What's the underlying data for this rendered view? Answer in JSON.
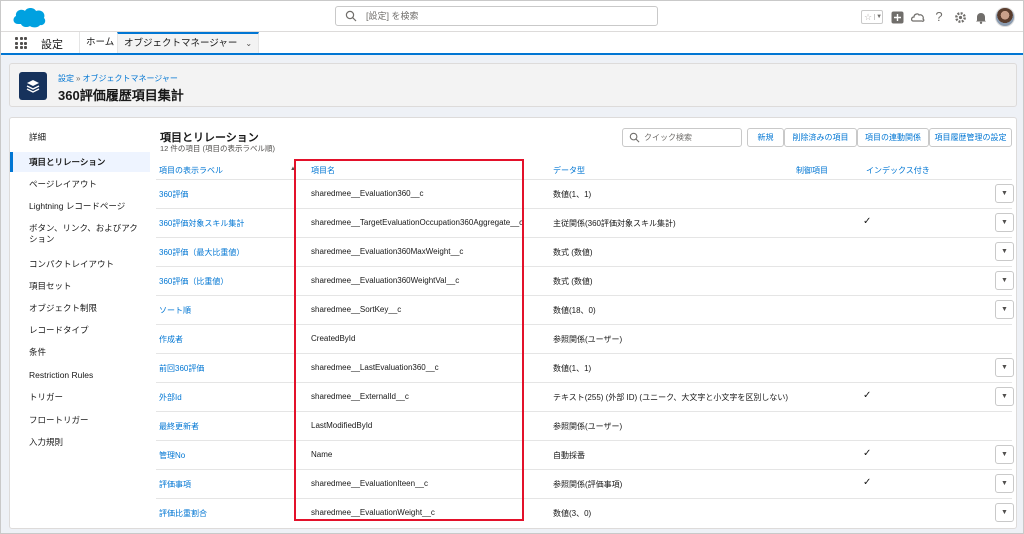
{
  "header": {
    "search_placeholder": "[設定] を検索"
  },
  "nav": {
    "app_name": "設定",
    "tabs": [
      {
        "label": "ホーム"
      },
      {
        "label": "オブジェクトマネージャー"
      }
    ]
  },
  "page": {
    "breadcrumb": [
      "設定",
      "オブジェクトマネージャー"
    ],
    "breadcrumb_sep": "»",
    "title": "360評価履歴項目集計"
  },
  "sidebar": {
    "items": [
      {
        "label": "詳細"
      },
      {
        "label": "項目とリレーション"
      },
      {
        "label": "ページレイアウト"
      },
      {
        "label": "Lightning レコードページ"
      },
      {
        "label": "ボタン、リンク、およびアクション"
      },
      {
        "label": "コンパクトレイアウト"
      },
      {
        "label": "項目セット"
      },
      {
        "label": "オブジェクト制限"
      },
      {
        "label": "レコードタイプ"
      },
      {
        "label": "条件"
      },
      {
        "label": "Restriction Rules"
      },
      {
        "label": "トリガー"
      },
      {
        "label": "フロートリガー"
      },
      {
        "label": "入力規則"
      }
    ]
  },
  "section": {
    "title": "項目とリレーション",
    "subtitle": "12 件の項目 (項目の表示ラベル順)",
    "quick_search_placeholder": "クイック検索",
    "buttons": [
      {
        "label": "新規"
      },
      {
        "label": "削除済みの項目"
      },
      {
        "label": "項目の連動関係"
      },
      {
        "label": "項目履歴管理の設定"
      }
    ]
  },
  "table": {
    "columns": [
      "項目の表示ラベル",
      "項目名",
      "データ型",
      "制御項目",
      "インデックス付き"
    ],
    "rows": [
      {
        "label": "360評価",
        "api": "sharedmee__Evaluation360__c",
        "type": "数値(1、1)",
        "indexed": false,
        "menu": true
      },
      {
        "label": "360評価対象スキル集計",
        "api": "sharedmee__TargetEvaluationOccupation360Aggregate__c",
        "type": "主従関係(360評価対象スキル集計)",
        "indexed": true,
        "menu": true
      },
      {
        "label": "360評価（最大比重値）",
        "api": "sharedmee__Evaluation360MaxWeight__c",
        "type": "数式 (数値)",
        "indexed": false,
        "menu": true
      },
      {
        "label": "360評価（比重値）",
        "api": "sharedmee__Evaluation360WeightVal__c",
        "type": "数式 (数値)",
        "indexed": false,
        "menu": true
      },
      {
        "label": "ソート順",
        "api": "sharedmee__SortKey__c",
        "type": "数値(18、0)",
        "indexed": false,
        "menu": true
      },
      {
        "label": "作成者",
        "api": "CreatedById",
        "type": "参照関係(ユーザー)",
        "indexed": false,
        "menu": false
      },
      {
        "label": "前回360評価",
        "api": "sharedmee__LastEvaluation360__c",
        "type": "数値(1、1)",
        "indexed": false,
        "menu": true
      },
      {
        "label": "外部Id",
        "api": "sharedmee__ExternalId__c",
        "type": "テキスト(255) (外部 ID) (ユニーク、大文字と小文字を区別しない)",
        "indexed": true,
        "menu": true
      },
      {
        "label": "最終更新者",
        "api": "LastModifiedById",
        "type": "参照関係(ユーザー)",
        "indexed": false,
        "menu": false
      },
      {
        "label": "管理No",
        "api": "Name",
        "type": "自動採番",
        "indexed": true,
        "menu": true
      },
      {
        "label": "評価事項",
        "api": "sharedmee__EvaluationIteen__c",
        "type": "参照関係(評価事項)",
        "indexed": true,
        "menu": true
      },
      {
        "label": "評価比重割合",
        "api": "sharedmee__EvaluationWeight__c",
        "type": "数値(3、0)",
        "indexed": false,
        "menu": true
      }
    ],
    "check_glyph": "✓",
    "menu_glyph": "▼"
  },
  "colors": {
    "brand_blue": "#0176d3",
    "highlight_red": "#e3112a",
    "object_icon": "#16325c",
    "logo_blue": "#00a1e0"
  }
}
